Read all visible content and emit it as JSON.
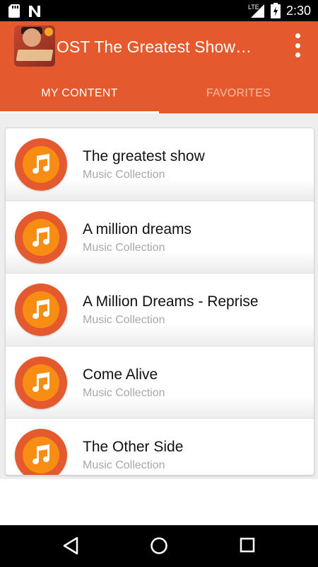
{
  "status_bar": {
    "time": "2:30",
    "network": "LTE",
    "icons": [
      "sd-card-icon",
      "n-notification-icon",
      "lte-signal-icon",
      "battery-charging-icon"
    ]
  },
  "app_bar": {
    "title": "OST The Greatest Show…",
    "icon": "app-poster-icon",
    "menu_icon": "overflow-menu-icon",
    "color": "#e45a2e"
  },
  "tabs": [
    {
      "label": "MY CONTENT",
      "selected": true
    },
    {
      "label": "FAVORITES",
      "selected": false
    }
  ],
  "list": {
    "items": [
      {
        "title": "The greatest show",
        "subtitle": "Music Collection"
      },
      {
        "title": "A million dreams",
        "subtitle": "Music Collection"
      },
      {
        "title": "A Million Dreams - Reprise",
        "subtitle": "Music Collection"
      },
      {
        "title": "Come Alive",
        "subtitle": "Music Collection"
      },
      {
        "title": "The Other Side",
        "subtitle": "Music Collection"
      }
    ],
    "item_icon": "music-note-icon",
    "disc_outer_color": "#e45a2e",
    "disc_inner_color": "#f88d13"
  },
  "nav_bar": {
    "buttons": [
      "back-icon",
      "home-icon",
      "recents-icon"
    ]
  }
}
